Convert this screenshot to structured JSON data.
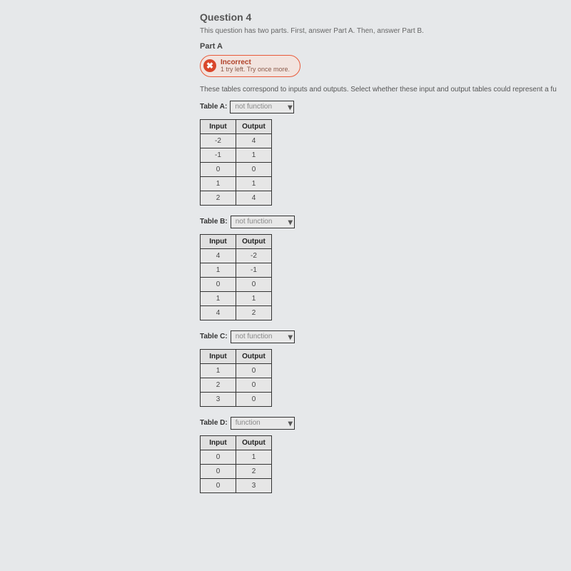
{
  "question": {
    "title": "Question 4",
    "instructions": "This question has two parts. First, answer Part A. Then, answer Part B.",
    "part_label": "Part A",
    "feedback": {
      "status": "Incorrect",
      "sub": "1 try left. Try once more."
    },
    "prompt": "These tables correspond to inputs and outputs. Select whether these input and output tables could represent a fu"
  },
  "tables": [
    {
      "label": "Table A:",
      "selected": "not function",
      "headers": [
        "Input",
        "Output"
      ],
      "rows": [
        [
          "-2",
          "4"
        ],
        [
          "-1",
          "1"
        ],
        [
          "0",
          "0"
        ],
        [
          "1",
          "1"
        ],
        [
          "2",
          "4"
        ]
      ]
    },
    {
      "label": "Table B:",
      "selected": "not function",
      "headers": [
        "Input",
        "Output"
      ],
      "rows": [
        [
          "4",
          "-2"
        ],
        [
          "1",
          "-1"
        ],
        [
          "0",
          "0"
        ],
        [
          "1",
          "1"
        ],
        [
          "4",
          "2"
        ]
      ]
    },
    {
      "label": "Table C:",
      "selected": "not function",
      "headers": [
        "Input",
        "Output"
      ],
      "rows": [
        [
          "1",
          "0"
        ],
        [
          "2",
          "0"
        ],
        [
          "3",
          "0"
        ]
      ]
    },
    {
      "label": "Table D:",
      "selected": "function",
      "headers": [
        "Input",
        "Output"
      ],
      "rows": [
        [
          "0",
          "1"
        ],
        [
          "0",
          "2"
        ],
        [
          "0",
          "3"
        ]
      ]
    }
  ]
}
